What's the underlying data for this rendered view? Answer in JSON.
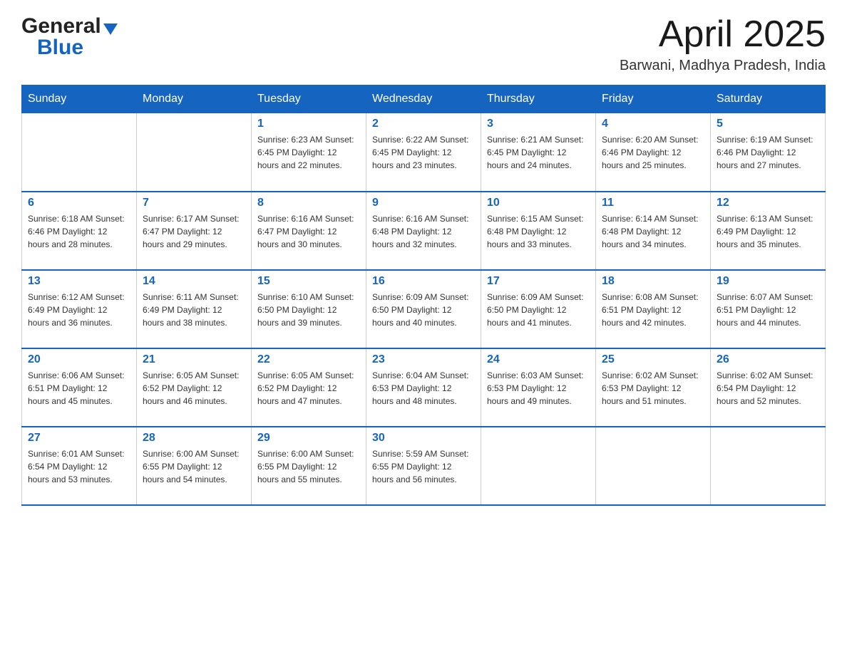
{
  "header": {
    "logo_general": "General",
    "logo_blue": "Blue",
    "month_title": "April 2025",
    "subtitle": "Barwani, Madhya Pradesh, India"
  },
  "days_of_week": [
    "Sunday",
    "Monday",
    "Tuesday",
    "Wednesday",
    "Thursday",
    "Friday",
    "Saturday"
  ],
  "weeks": [
    [
      {
        "day": "",
        "info": ""
      },
      {
        "day": "",
        "info": ""
      },
      {
        "day": "1",
        "info": "Sunrise: 6:23 AM\nSunset: 6:45 PM\nDaylight: 12 hours\nand 22 minutes."
      },
      {
        "day": "2",
        "info": "Sunrise: 6:22 AM\nSunset: 6:45 PM\nDaylight: 12 hours\nand 23 minutes."
      },
      {
        "day": "3",
        "info": "Sunrise: 6:21 AM\nSunset: 6:45 PM\nDaylight: 12 hours\nand 24 minutes."
      },
      {
        "day": "4",
        "info": "Sunrise: 6:20 AM\nSunset: 6:46 PM\nDaylight: 12 hours\nand 25 minutes."
      },
      {
        "day": "5",
        "info": "Sunrise: 6:19 AM\nSunset: 6:46 PM\nDaylight: 12 hours\nand 27 minutes."
      }
    ],
    [
      {
        "day": "6",
        "info": "Sunrise: 6:18 AM\nSunset: 6:46 PM\nDaylight: 12 hours\nand 28 minutes."
      },
      {
        "day": "7",
        "info": "Sunrise: 6:17 AM\nSunset: 6:47 PM\nDaylight: 12 hours\nand 29 minutes."
      },
      {
        "day": "8",
        "info": "Sunrise: 6:16 AM\nSunset: 6:47 PM\nDaylight: 12 hours\nand 30 minutes."
      },
      {
        "day": "9",
        "info": "Sunrise: 6:16 AM\nSunset: 6:48 PM\nDaylight: 12 hours\nand 32 minutes."
      },
      {
        "day": "10",
        "info": "Sunrise: 6:15 AM\nSunset: 6:48 PM\nDaylight: 12 hours\nand 33 minutes."
      },
      {
        "day": "11",
        "info": "Sunrise: 6:14 AM\nSunset: 6:48 PM\nDaylight: 12 hours\nand 34 minutes."
      },
      {
        "day": "12",
        "info": "Sunrise: 6:13 AM\nSunset: 6:49 PM\nDaylight: 12 hours\nand 35 minutes."
      }
    ],
    [
      {
        "day": "13",
        "info": "Sunrise: 6:12 AM\nSunset: 6:49 PM\nDaylight: 12 hours\nand 36 minutes."
      },
      {
        "day": "14",
        "info": "Sunrise: 6:11 AM\nSunset: 6:49 PM\nDaylight: 12 hours\nand 38 minutes."
      },
      {
        "day": "15",
        "info": "Sunrise: 6:10 AM\nSunset: 6:50 PM\nDaylight: 12 hours\nand 39 minutes."
      },
      {
        "day": "16",
        "info": "Sunrise: 6:09 AM\nSunset: 6:50 PM\nDaylight: 12 hours\nand 40 minutes."
      },
      {
        "day": "17",
        "info": "Sunrise: 6:09 AM\nSunset: 6:50 PM\nDaylight: 12 hours\nand 41 minutes."
      },
      {
        "day": "18",
        "info": "Sunrise: 6:08 AM\nSunset: 6:51 PM\nDaylight: 12 hours\nand 42 minutes."
      },
      {
        "day": "19",
        "info": "Sunrise: 6:07 AM\nSunset: 6:51 PM\nDaylight: 12 hours\nand 44 minutes."
      }
    ],
    [
      {
        "day": "20",
        "info": "Sunrise: 6:06 AM\nSunset: 6:51 PM\nDaylight: 12 hours\nand 45 minutes."
      },
      {
        "day": "21",
        "info": "Sunrise: 6:05 AM\nSunset: 6:52 PM\nDaylight: 12 hours\nand 46 minutes."
      },
      {
        "day": "22",
        "info": "Sunrise: 6:05 AM\nSunset: 6:52 PM\nDaylight: 12 hours\nand 47 minutes."
      },
      {
        "day": "23",
        "info": "Sunrise: 6:04 AM\nSunset: 6:53 PM\nDaylight: 12 hours\nand 48 minutes."
      },
      {
        "day": "24",
        "info": "Sunrise: 6:03 AM\nSunset: 6:53 PM\nDaylight: 12 hours\nand 49 minutes."
      },
      {
        "day": "25",
        "info": "Sunrise: 6:02 AM\nSunset: 6:53 PM\nDaylight: 12 hours\nand 51 minutes."
      },
      {
        "day": "26",
        "info": "Sunrise: 6:02 AM\nSunset: 6:54 PM\nDaylight: 12 hours\nand 52 minutes."
      }
    ],
    [
      {
        "day": "27",
        "info": "Sunrise: 6:01 AM\nSunset: 6:54 PM\nDaylight: 12 hours\nand 53 minutes."
      },
      {
        "day": "28",
        "info": "Sunrise: 6:00 AM\nSunset: 6:55 PM\nDaylight: 12 hours\nand 54 minutes."
      },
      {
        "day": "29",
        "info": "Sunrise: 6:00 AM\nSunset: 6:55 PM\nDaylight: 12 hours\nand 55 minutes."
      },
      {
        "day": "30",
        "info": "Sunrise: 5:59 AM\nSunset: 6:55 PM\nDaylight: 12 hours\nand 56 minutes."
      },
      {
        "day": "",
        "info": ""
      },
      {
        "day": "",
        "info": ""
      },
      {
        "day": "",
        "info": ""
      }
    ]
  ]
}
